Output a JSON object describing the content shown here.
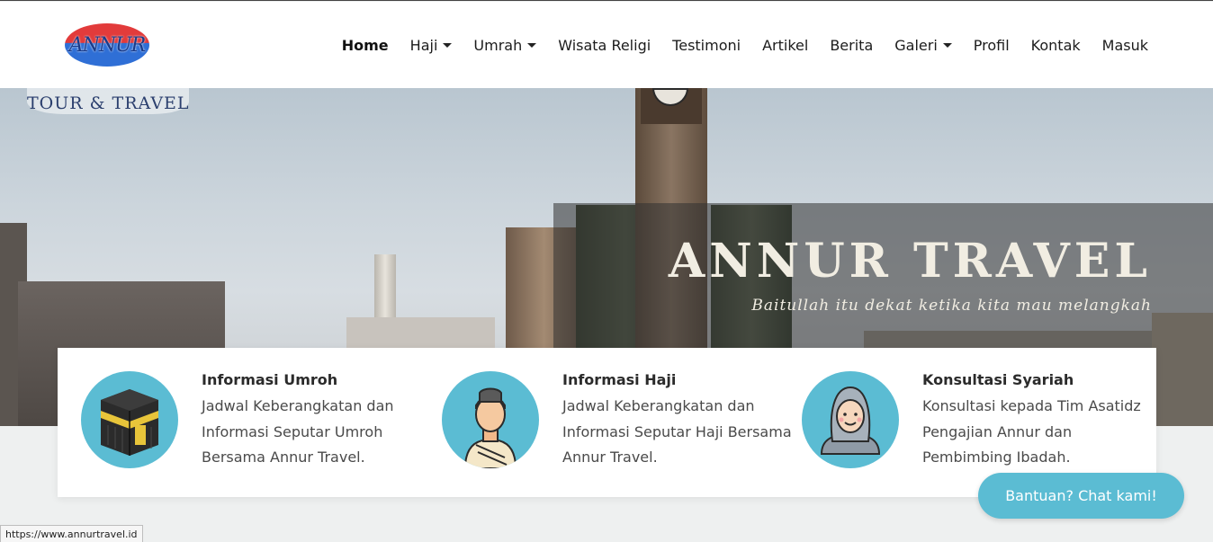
{
  "brand": {
    "logo_text": "ANNUR",
    "subtitle": "TOUR & TRAVEL"
  },
  "nav": {
    "items": [
      {
        "label": "Home",
        "active": true,
        "dropdown": false
      },
      {
        "label": "Haji",
        "active": false,
        "dropdown": true
      },
      {
        "label": "Umrah",
        "active": false,
        "dropdown": true
      },
      {
        "label": "Wisata Religi",
        "active": false,
        "dropdown": false
      },
      {
        "label": "Testimoni",
        "active": false,
        "dropdown": false
      },
      {
        "label": "Artikel",
        "active": false,
        "dropdown": false
      },
      {
        "label": "Berita",
        "active": false,
        "dropdown": false
      },
      {
        "label": "Galeri",
        "active": false,
        "dropdown": true
      },
      {
        "label": "Profil",
        "active": false,
        "dropdown": false
      },
      {
        "label": "Kontak",
        "active": false,
        "dropdown": false
      },
      {
        "label": "Masuk",
        "active": false,
        "dropdown": false
      }
    ]
  },
  "hero": {
    "title": "ANNUR TRAVEL",
    "tagline": "Baitullah itu dekat ketika kita mau melangkah"
  },
  "features": [
    {
      "icon": "kaaba-icon",
      "title": "Informasi Umroh",
      "desc": "Jadwal Keberangkatan dan Informasi Seputar Umroh Bersama Annur Travel."
    },
    {
      "icon": "pilgrim-man-icon",
      "title": "Informasi Haji",
      "desc": "Jadwal Keberangkatan dan Informasi Seputar Haji Bersama Annur Travel."
    },
    {
      "icon": "hijab-woman-icon",
      "title": "Konsultasi Syariah",
      "desc": "Konsultasi kepada Tim Asatidz Pengajian Annur dan Pembimbing Ibadah."
    }
  ],
  "help_button": "Bantuan? Chat kami!",
  "status_url": "https://www.annurtravel.id",
  "colors": {
    "accent": "#5bbcd3",
    "nav_text": "#1c1c1c",
    "overlay": "#323232"
  }
}
